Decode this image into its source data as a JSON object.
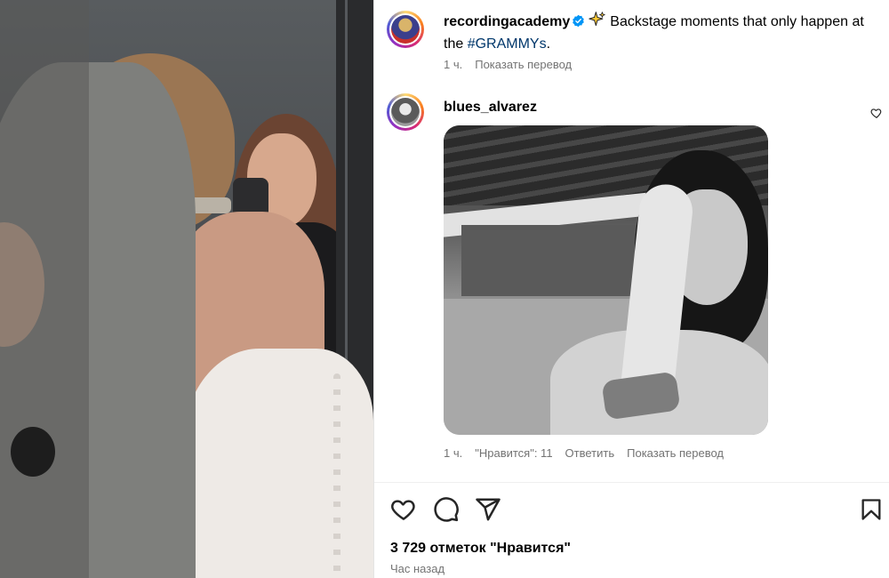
{
  "post": {
    "author": "recordingacademy",
    "caption_text": "Backstage moments that only happen at the ",
    "hashtag": "#GRAMMYs",
    "caption_end": ".",
    "time": "1 ч.",
    "translate_label": "Показать перевод"
  },
  "comment": {
    "author": "blues_alvarez",
    "time": "1 ч.",
    "likes_label": "\"Нравится\": 11",
    "reply_label": "Ответить",
    "translate_label": "Показать перевод"
  },
  "footer": {
    "likes_text": "3 729 отметок \"Нравится\"",
    "posted_ago": "Час назад"
  },
  "icons": {
    "post_verified": "verified-badge-icon",
    "caption_emoji": "sparkles-icon",
    "comment_like": "heart-icon",
    "like": "heart-icon",
    "comment": "comment-bubble-icon",
    "share": "paper-plane-icon",
    "save": "bookmark-icon"
  },
  "colors": {
    "verified_blue": "#0095f6",
    "hashtag": "#00376b",
    "secondary_text": "#737373"
  }
}
